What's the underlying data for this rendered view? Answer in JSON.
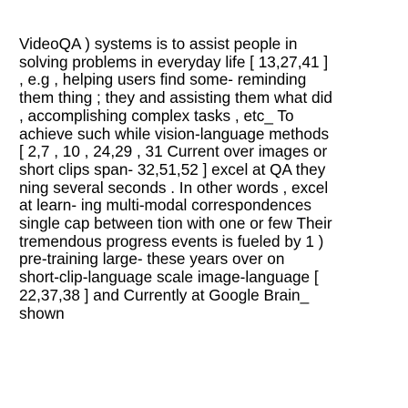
{
  "document": {
    "lines": [
      "VideoQA ) systems is to assist people in",
      "solving problems in everyday life [ 13,27,41 ]",
      ", e.g , helping users find some- reminding",
      "them thing ; they and assisting them what did",
      ", accomplishing complex tasks , etc_ To",
      "achieve such while vision-language methods",
      "[ 2,7 , 10 , 24,29 , 31 Current over images or",
      "short clips span- 32,51,52 ] excel at QA they",
      "ning several seconds . In other words , excel",
      "at learn- ing multi-modal correspondences",
      "single cap between tion with one or few Their",
      "tremendous progress events is fueled by 1 )",
      "pre-training large- these years over on",
      "short-clip-language scale image-language [",
      "22,37,38 ] and Currently at Google Brain_",
      "shown"
    ]
  }
}
